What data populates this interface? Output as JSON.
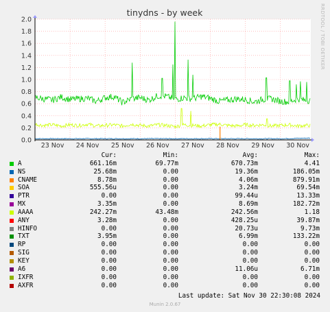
{
  "side_label": "RRDTOOL / TOBI OETIKER",
  "footer": {
    "last_update": "Last update: Sat Nov 30 22:30:08 2024",
    "munin": "Munin 2.0.67"
  },
  "legend_headers": {
    "cur": "Cur:",
    "min": "Min:",
    "avg": "Avg:",
    "max": "Max:"
  },
  "legend": [
    {
      "name": "A",
      "color": "#00cc00",
      "cur": "661.16m",
      "min": "69.77m",
      "avg": "670.73m",
      "max": "4.41"
    },
    {
      "name": "NS",
      "color": "#0066b3",
      "cur": "25.68m",
      "min": "0.00",
      "avg": "19.36m",
      "max": "186.05m"
    },
    {
      "name": "CNAME",
      "color": "#ff8000",
      "cur": "8.78m",
      "min": "0.00",
      "avg": "4.06m",
      "max": "879.91m"
    },
    {
      "name": "SOA",
      "color": "#ffcc00",
      "cur": "555.56u",
      "min": "0.00",
      "avg": "3.24m",
      "max": "69.54m"
    },
    {
      "name": "PTR",
      "color": "#330099",
      "cur": "0.00",
      "min": "0.00",
      "avg": "99.44u",
      "max": "13.33m"
    },
    {
      "name": "MX",
      "color": "#990099",
      "cur": "3.35m",
      "min": "0.00",
      "avg": "8.69m",
      "max": "182.72m"
    },
    {
      "name": "AAAA",
      "color": "#ccff00",
      "cur": "242.27m",
      "min": "43.48m",
      "avg": "242.56m",
      "max": "1.18"
    },
    {
      "name": "ANY",
      "color": "#ff0000",
      "cur": "3.28m",
      "min": "0.00",
      "avg": "428.25u",
      "max": "39.87m"
    },
    {
      "name": "HINFO",
      "color": "#808080",
      "cur": "0.00",
      "min": "0.00",
      "avg": "20.73u",
      "max": "9.73m"
    },
    {
      "name": "TXT",
      "color": "#008f00",
      "cur": "3.95m",
      "min": "0.00",
      "avg": "6.99m",
      "max": "133.22m"
    },
    {
      "name": "RP",
      "color": "#00487d",
      "cur": "0.00",
      "min": "0.00",
      "avg": "0.00",
      "max": "0.00"
    },
    {
      "name": "SIG",
      "color": "#b35a00",
      "cur": "0.00",
      "min": "0.00",
      "avg": "0.00",
      "max": "0.00"
    },
    {
      "name": "KEY",
      "color": "#b38f00",
      "cur": "0.00",
      "min": "0.00",
      "avg": "0.00",
      "max": "0.00"
    },
    {
      "name": "A6",
      "color": "#6b006b",
      "cur": "0.00",
      "min": "0.00",
      "avg": "11.06u",
      "max": "6.71m"
    },
    {
      "name": "IXFR",
      "color": "#8fb300",
      "cur": "0.00",
      "min": "0.00",
      "avg": "0.00",
      "max": "0.00"
    },
    {
      "name": "AXFR",
      "color": "#b30000",
      "cur": "0.00",
      "min": "0.00",
      "avg": "0.00",
      "max": "0.00"
    }
  ],
  "chart_data": {
    "type": "line",
    "title": "tinydns - by week",
    "ylim": [
      0,
      2.0
    ],
    "yticks": [
      0.0,
      0.2,
      0.4,
      0.6,
      0.8,
      1.0,
      1.2,
      1.4,
      1.6,
      1.8,
      2.0
    ],
    "ytick_labels": [
      "0.0",
      "0.2",
      "0.4",
      "0.6",
      "0.8",
      "1.0",
      "1.2",
      "1.4",
      "1.6",
      "1.8",
      "2.0"
    ],
    "xlim": [
      0,
      7.87
    ],
    "xticks": [
      {
        "label": "23 Nov",
        "pos": 1.0
      },
      {
        "label": "24 Nov",
        "pos": 2.0
      },
      {
        "label": "25 Nov",
        "pos": 3.0
      },
      {
        "label": "26 Nov",
        "pos": 4.0
      },
      {
        "label": "27 Nov",
        "pos": 5.0
      },
      {
        "label": "28 Nov",
        "pos": 6.0
      },
      {
        "label": "29 Nov",
        "pos": 7.0
      },
      {
        "label": "30 Nov",
        "pos": 8.0
      }
    ],
    "grid": true,
    "series": [
      {
        "name": "A",
        "color": "#00cc00",
        "x": [
          0,
          0.25,
          0.5,
          0.75,
          1.0,
          1.25,
          1.5,
          1.75,
          2.0,
          2.25,
          2.5,
          2.75,
          3.0,
          3.25,
          3.5,
          3.75,
          4.0,
          4.25,
          4.5,
          4.75,
          5.0,
          5.25,
          5.5,
          5.75,
          6.0,
          6.25,
          6.5,
          6.75,
          7.0,
          7.25,
          7.5,
          7.75,
          7.87
        ],
        "y": [
          0.7,
          0.68,
          0.66,
          0.71,
          0.67,
          0.68,
          0.69,
          0.64,
          0.7,
          0.72,
          0.62,
          0.68,
          0.7,
          0.66,
          0.73,
          0.72,
          0.67,
          0.7,
          0.68,
          0.72,
          0.69,
          0.64,
          0.66,
          0.68,
          0.67,
          0.63,
          0.67,
          0.68,
          0.64,
          0.63,
          0.68,
          0.65,
          0.66
        ]
      },
      {
        "name": "AAAA",
        "color": "#ccff00",
        "x": [
          0,
          0.25,
          0.5,
          0.75,
          1.0,
          1.25,
          1.5,
          1.75,
          2.0,
          2.25,
          2.5,
          2.75,
          3.0,
          3.25,
          3.5,
          3.75,
          4.0,
          4.25,
          4.5,
          4.75,
          5.0,
          5.25,
          5.5,
          5.75,
          6.0,
          6.25,
          6.5,
          6.75,
          7.0,
          7.25,
          7.5,
          7.75,
          7.87
        ],
        "y": [
          0.26,
          0.24,
          0.25,
          0.23,
          0.25,
          0.24,
          0.26,
          0.23,
          0.24,
          0.25,
          0.23,
          0.26,
          0.24,
          0.23,
          0.25,
          0.24,
          0.22,
          0.25,
          0.24,
          0.23,
          0.25,
          0.26,
          0.24,
          0.23,
          0.25,
          0.24,
          0.25,
          0.23,
          0.24,
          0.25,
          0.23,
          0.24,
          0.24
        ]
      },
      {
        "name": "NS",
        "color": "#0066b3",
        "x": [
          0,
          1.0,
          2.0,
          3.0,
          4.0,
          5.0,
          6.0,
          7.0,
          7.87
        ],
        "y": [
          0.02,
          0.02,
          0.02,
          0.02,
          0.02,
          0.02,
          0.02,
          0.02,
          0.03
        ]
      }
    ],
    "spikes_A": [
      {
        "x": 2.77,
        "y": 1.28
      },
      {
        "x": 3.63,
        "y": 1.02
      },
      {
        "x": 3.94,
        "y": 1.25
      },
      {
        "x": 4.0,
        "y": 1.96
      },
      {
        "x": 4.37,
        "y": 1.33
      },
      {
        "x": 4.5,
        "y": 1.08
      },
      {
        "x": 6.6,
        "y": 1.03
      },
      {
        "x": 7.27,
        "y": 0.98
      },
      {
        "x": 7.45,
        "y": 0.92
      },
      {
        "x": 7.58,
        "y": 0.97
      },
      {
        "x": 7.75,
        "y": 0.96
      }
    ],
    "spikes_AAAA": [
      {
        "x": 4.18,
        "y": 0.52
      },
      {
        "x": 4.45,
        "y": 0.48
      },
      {
        "x": 6.62,
        "y": 0.35
      }
    ],
    "spikes_CNAME": [
      {
        "x": 5.28,
        "y": 0.22
      }
    ]
  }
}
